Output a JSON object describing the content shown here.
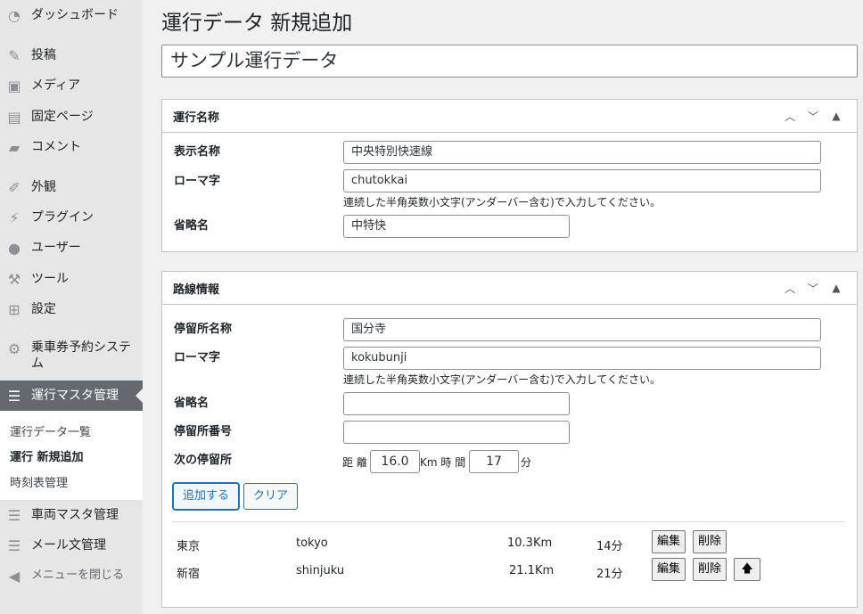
{
  "sidebar": {
    "items": [
      {
        "label": "ダッシュボード",
        "icon": "dashboard-icon"
      },
      {
        "label": "投稿",
        "icon": "pin-icon"
      },
      {
        "label": "メディア",
        "icon": "media-icon"
      },
      {
        "label": "固定ページ",
        "icon": "page-icon"
      },
      {
        "label": "コメント",
        "icon": "comment-icon"
      },
      {
        "label": "外観",
        "icon": "brush-icon"
      },
      {
        "label": "プラグイン",
        "icon": "plugin-icon"
      },
      {
        "label": "ユーザー",
        "icon": "user-icon"
      },
      {
        "label": "ツール",
        "icon": "wrench-icon"
      },
      {
        "label": "設定",
        "icon": "settings-icon"
      },
      {
        "label": "乗車券予約システム",
        "icon": "gear-icon"
      },
      {
        "label": "運行マスタ管理",
        "icon": "list-icon"
      },
      {
        "label": "車両マスタ管理",
        "icon": "list-icon"
      },
      {
        "label": "メール文管理",
        "icon": "list-icon"
      },
      {
        "label": "メニューを閉じる",
        "icon": "collapse-icon"
      }
    ],
    "submenu": [
      "運行データ一覧",
      "運行 新規追加",
      "時刻表管理"
    ]
  },
  "page": {
    "title": "運行データ 新規追加",
    "post_title": "サンプル運行データ"
  },
  "box1": {
    "title": "運行名称",
    "display_name_label": "表示名称",
    "display_name_value": "中央特別快速線",
    "romaji_label": "ローマ字",
    "romaji_value": "chutokkai",
    "romaji_hint": "連続した半角英数小文字(アンダーバー含む)で入力してください。",
    "abbr_label": "省略名",
    "abbr_value": "中特快"
  },
  "box2": {
    "title": "路線情報",
    "stop_name_label": "停留所名称",
    "stop_name_value": "国分寺",
    "romaji_label": "ローマ字",
    "romaji_value": "kokubunji",
    "romaji_hint": "連続した半角英数小文字(アンダーバー含む)で入力してください。",
    "abbr_label": "省略名",
    "abbr_value": "",
    "stop_no_label": "停留所番号",
    "stop_no_value": "",
    "next_stop_label": "次の停留所",
    "distance_label": "距 離",
    "distance_value": "16.0",
    "km_time_label": "Km 時 間",
    "time_value": "17",
    "min_label": "分",
    "add_button": "追加する",
    "clear_button": "クリア",
    "rows": [
      {
        "name": "東京",
        "romaji": "tokyo",
        "distance": "10.3Km",
        "time": "14分"
      },
      {
        "name": "新宿",
        "romaji": "shinjuku",
        "distance": "21.1Km",
        "time": "21分"
      }
    ],
    "edit_button": "編集",
    "delete_button": "削除",
    "up_button": "🡅"
  },
  "controls": {
    "up": "︿",
    "down": "﹀",
    "toggle": "▲"
  }
}
